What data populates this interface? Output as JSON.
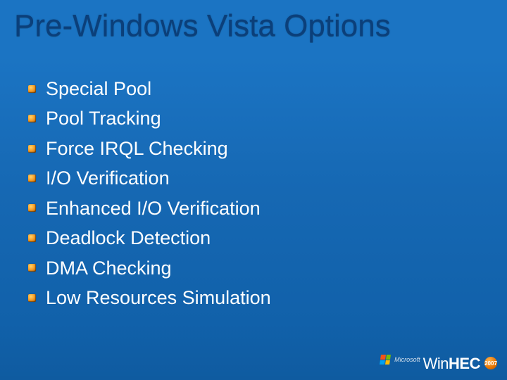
{
  "title": "Pre-Windows Vista Options",
  "items": [
    "Special Pool",
    "Pool Tracking",
    "Force IRQL Checking",
    "I/O Verification",
    "Enhanced I/O Verification",
    "Deadlock Detection",
    "DMA Checking",
    "Low Resources Simulation"
  ],
  "footer": {
    "brand_prefix": "Microsoft",
    "logo_win": "Win",
    "logo_hec": "HEC",
    "year": "2007"
  }
}
